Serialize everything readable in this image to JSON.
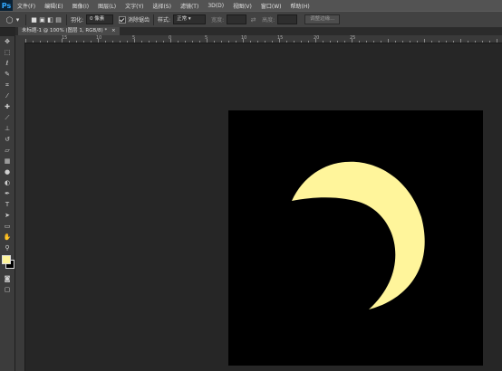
{
  "app": {
    "logo_text": "Ps"
  },
  "menu": [
    "文件(F)",
    "编辑(E)",
    "图像(I)",
    "图层(L)",
    "文字(Y)",
    "选择(S)",
    "滤镜(T)",
    "3D(D)",
    "视图(V)",
    "窗口(W)",
    "帮助(H)"
  ],
  "options": {
    "feather_label": "羽化:",
    "feather_value": "0 像素",
    "antialias_label": "消除锯齿",
    "style_label": "样式:",
    "style_value": "正常",
    "width_label": "宽度:",
    "height_label": "高度:",
    "refine_edge_button": "调整边缘..."
  },
  "document": {
    "tab_title": "未标题-1 @ 100% (图层 1, RGB/8) *",
    "tab_close": "×"
  },
  "ruler": {
    "top_labels": [
      "15",
      "10",
      "5",
      "0",
      "5",
      "10",
      "15",
      "20",
      "25"
    ]
  },
  "colors": {
    "canvas": "#000000",
    "moon": "#fff59b",
    "foreground": "#fff59b",
    "background": "#000000"
  },
  "tools": [
    "move-tool",
    "marquee-tool",
    "lasso-tool",
    "quick-selection-tool",
    "crop-tool",
    "eyedropper-tool",
    "spot-healing-tool",
    "brush-tool",
    "clone-stamp-tool",
    "history-brush-tool",
    "eraser-tool",
    "gradient-tool",
    "blur-tool",
    "dodge-tool",
    "pen-tool",
    "type-tool",
    "path-selection-tool",
    "shape-tool",
    "hand-tool",
    "zoom-tool"
  ]
}
